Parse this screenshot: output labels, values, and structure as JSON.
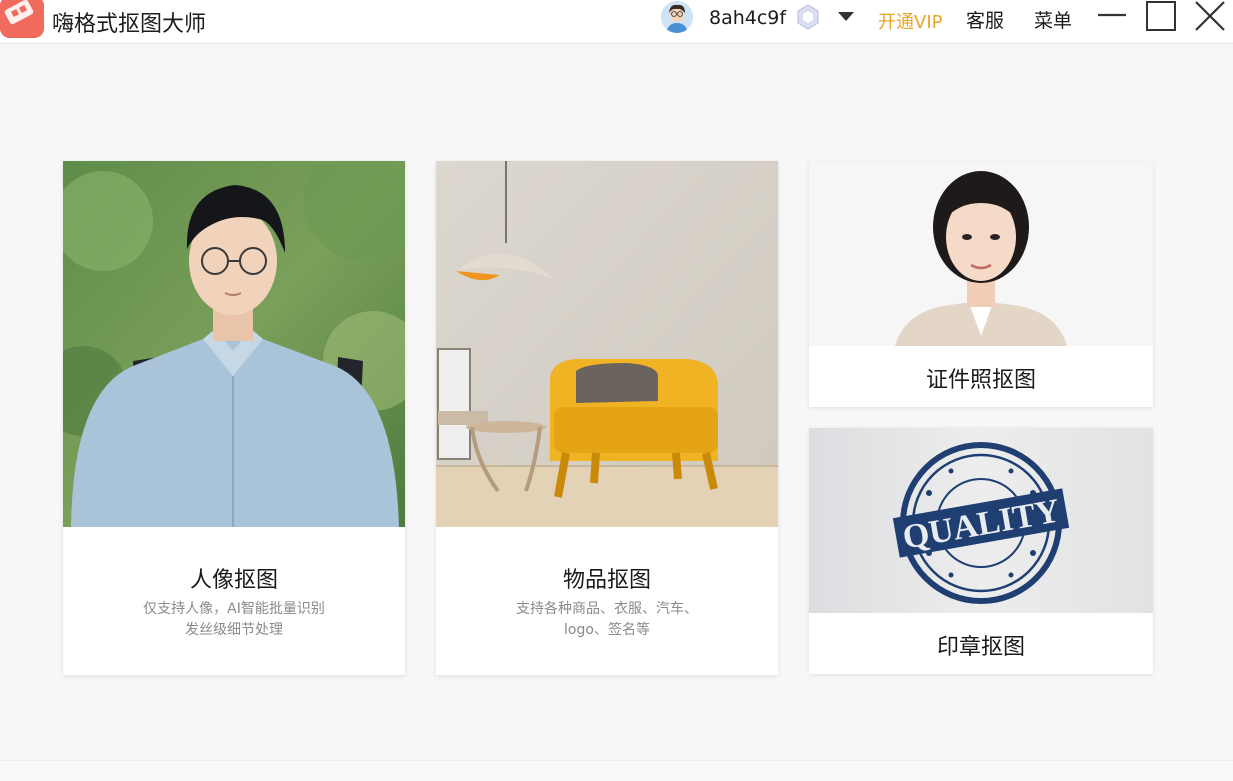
{
  "titlebar": {
    "app_title": "嗨格式抠图大师",
    "username": "8ah4c9f",
    "vip_label": "开通VIP",
    "service_label": "客服",
    "menu_label": "菜单"
  },
  "cards": {
    "portrait": {
      "title": "人像抠图",
      "desc_line1": "仅支持人像，AI智能批量识别",
      "desc_line2": "发丝级细节处理"
    },
    "object": {
      "title": "物品抠图",
      "desc_line1": "支持各种商品、衣服、汽车、",
      "desc_line2": "logo、签名等"
    },
    "id_photo": {
      "title": "证件照抠图"
    },
    "stamp": {
      "title": "印章抠图",
      "stamp_text": "QUALITY"
    }
  },
  "colors": {
    "logo": "#f06a5e",
    "vip": "#e7a52a",
    "stamp": "#1f3f73",
    "chair": "#f0b323"
  },
  "icons": [
    "app-logo-icon",
    "user-avatar-icon",
    "vip-badge-icon",
    "chevron-down-icon",
    "minimize-icon",
    "maximize-icon",
    "close-icon"
  ]
}
